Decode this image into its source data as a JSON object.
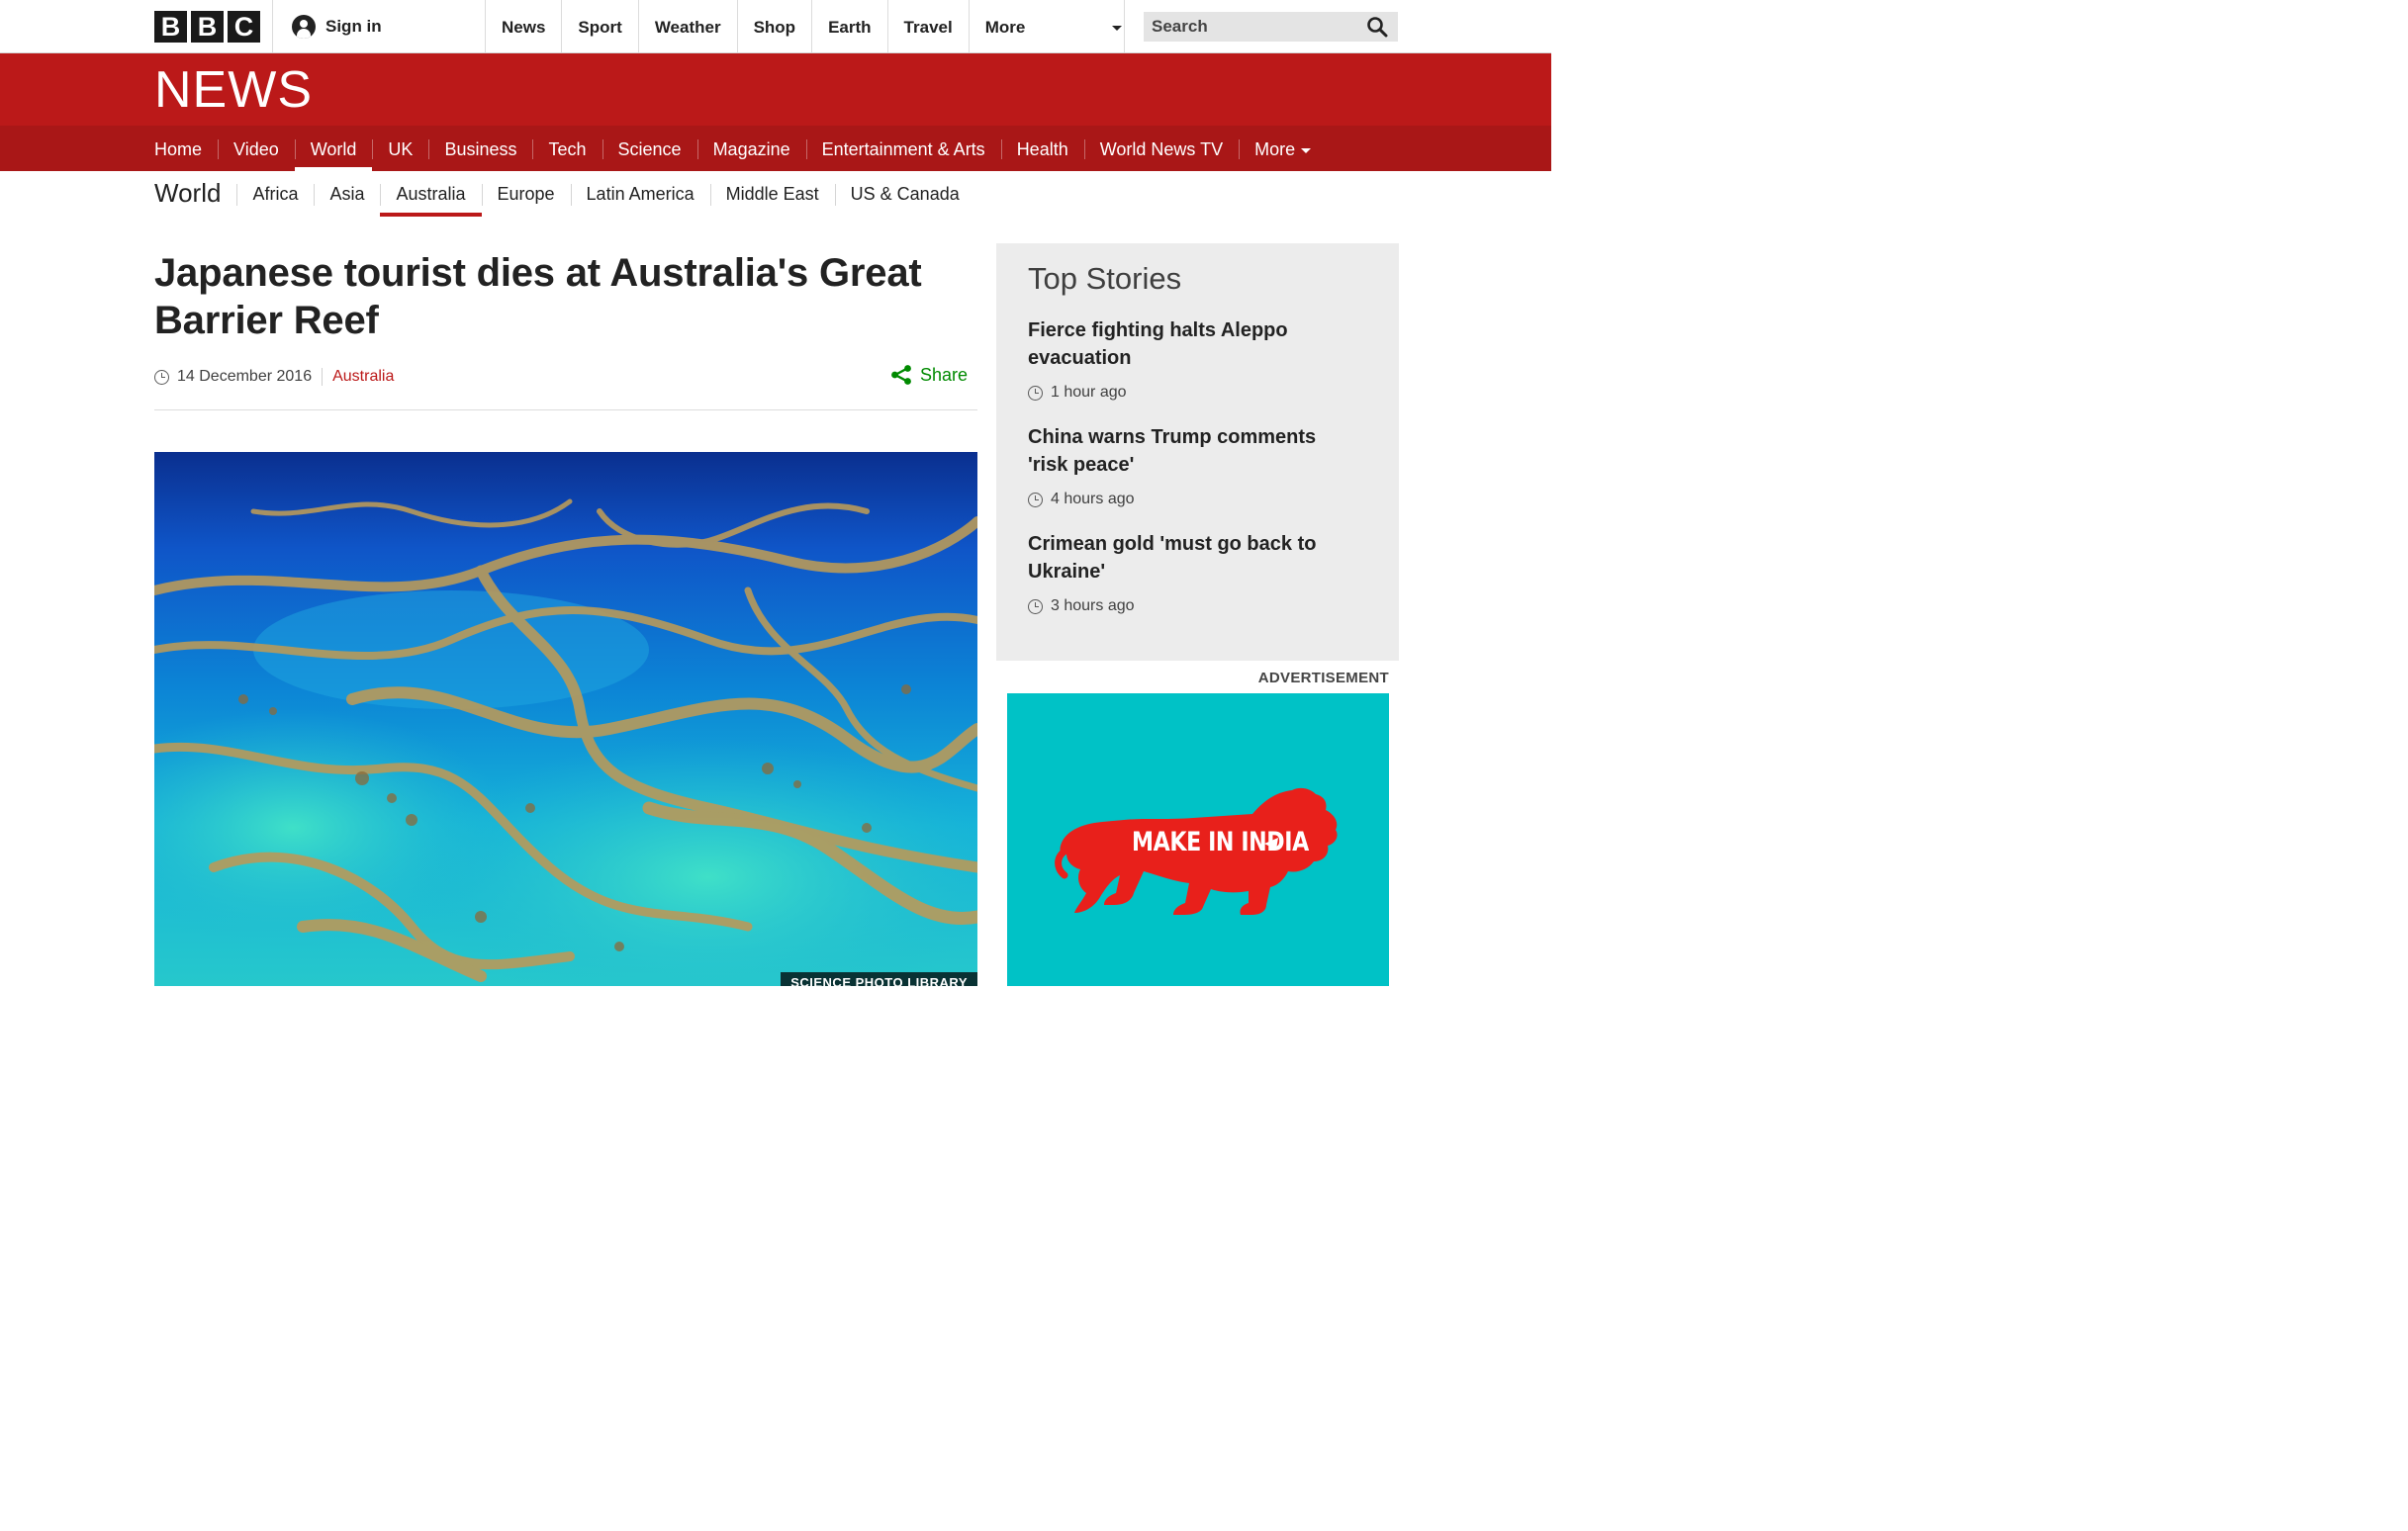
{
  "masthead": {
    "logo_letters": [
      "B",
      "B",
      "C"
    ],
    "signin_label": "Sign in",
    "nav": [
      "News",
      "Sport",
      "Weather",
      "Shop",
      "Earth",
      "Travel",
      "More"
    ],
    "search_placeholder": "Search"
  },
  "banner": {
    "title": "NEWS"
  },
  "main_nav": {
    "items": [
      "Home",
      "Video",
      "World",
      "UK",
      "Business",
      "Tech",
      "Science",
      "Magazine",
      "Entertainment & Arts",
      "Health",
      "World News TV",
      "More"
    ],
    "active": "World"
  },
  "sub_nav": {
    "title": "World",
    "items": [
      "Africa",
      "Asia",
      "Australia",
      "Europe",
      "Latin America",
      "Middle East",
      "US & Canada"
    ],
    "active": "Australia"
  },
  "article": {
    "headline": "Japanese tourist dies at Australia's Great Barrier Reef",
    "date": "14 December 2016",
    "section": "Australia",
    "share_label": "Share",
    "image_credit": "SCIENCE PHOTO LIBRARY"
  },
  "top_stories": {
    "title": "Top Stories",
    "stories": [
      {
        "title": "Fierce fighting halts Aleppo evacuation",
        "time": "1 hour ago"
      },
      {
        "title": "China warns Trump comments 'risk peace'",
        "time": "4 hours ago"
      },
      {
        "title": "Crimean gold 'must go back to Ukraine'",
        "time": "3 hours ago"
      }
    ]
  },
  "advertisement": {
    "label": "ADVERTISEMENT",
    "brand_text": "MAKE IN INDIA"
  },
  "colors": {
    "bbc_red": "#bb1919",
    "nav_red": "#a91717",
    "share_green": "#008a00",
    "ad_teal": "#00c2c6",
    "lion_red": "#e8201b"
  }
}
